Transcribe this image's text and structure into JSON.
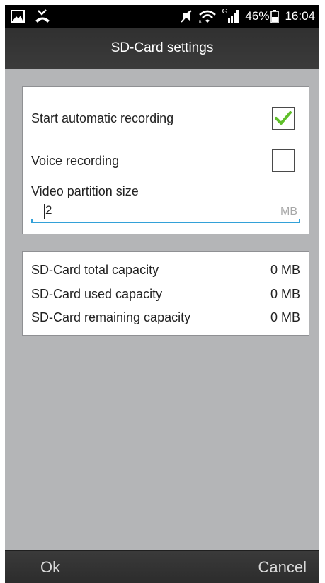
{
  "status_bar": {
    "battery_percent": "46%",
    "time": "16:04",
    "signal_label": "G",
    "icons": [
      "image-icon",
      "missed-call-icon",
      "mute-icon",
      "wifi-icon",
      "signal-icon",
      "battery-icon"
    ]
  },
  "header": {
    "title": "SD-Card settings"
  },
  "settings": {
    "auto_recording_label": "Start automatic recording",
    "auto_recording_checked": true,
    "voice_recording_label": "Voice recording",
    "voice_recording_checked": false,
    "partition_label": "Video partition size",
    "partition_value": "2",
    "partition_unit": "MB"
  },
  "capacity": {
    "rows": [
      {
        "label": "SD-Card total capacity",
        "value": "0 MB"
      },
      {
        "label": "SD-Card used capacity",
        "value": "0 MB"
      },
      {
        "label": "SD-Card remaining capacity",
        "value": "0 MB"
      }
    ]
  },
  "footer": {
    "ok_label": "Ok",
    "cancel_label": "Cancel"
  },
  "colors": {
    "accent_underline": "#33a1d8",
    "check_green": "#5fbf2a",
    "background": "#b4b5b7"
  }
}
